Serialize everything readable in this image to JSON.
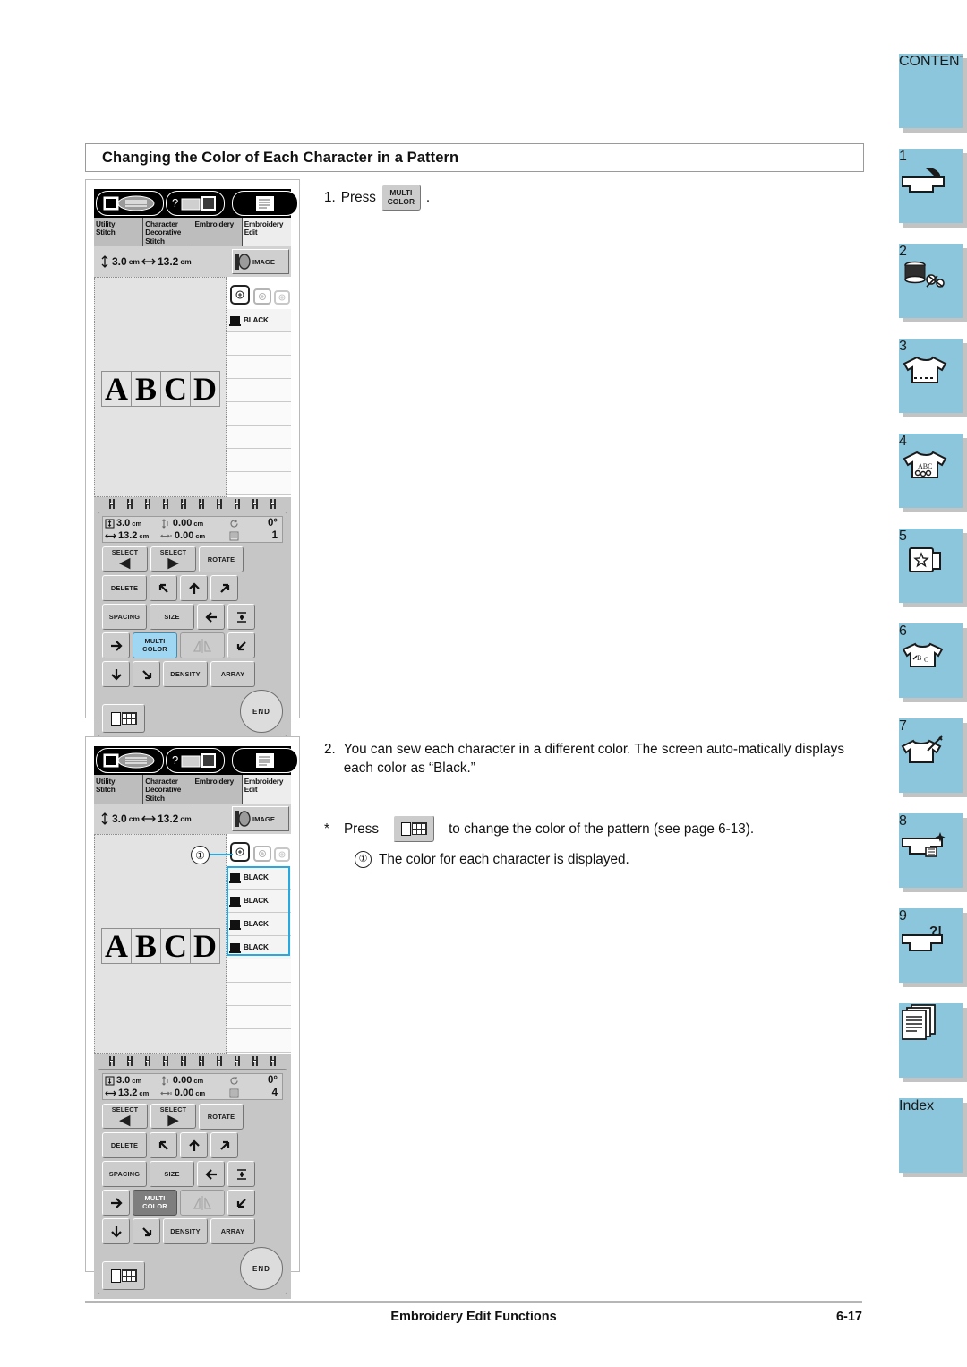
{
  "section": {
    "heading": "Changing the Color of Each Character in a Pattern"
  },
  "steps": {
    "step1": {
      "number": "1.",
      "press_label": "Press",
      "key_line1": "MULTI",
      "key_line2": "COLOR",
      "period": "."
    },
    "step2": {
      "number": "2.",
      "text": "You can sew each character in a different color. The screen auto-matically displays each color as “Black.”"
    },
    "note": {
      "bullet": "*",
      "press_label": "Press",
      "text_after": "to change the color of the pattern (see page 6-13).",
      "sub_marker": "①",
      "sub_text": "The color for each character is displayed."
    }
  },
  "callout": {
    "marker": "①"
  },
  "screen": {
    "tabs": [
      {
        "label": "Utility\nStitch",
        "active": false
      },
      {
        "label": "Character\nDecorative\nStitch",
        "active": false
      },
      {
        "label": "Embroidery",
        "active": false
      },
      {
        "label": "Embroidery\nEdit",
        "active": true
      }
    ],
    "size": {
      "height": "3.0",
      "height_unit": "cm",
      "width": "13.2",
      "width_unit": "cm"
    },
    "image_button": "IMAGE",
    "pattern_chars": [
      "A",
      "B",
      "C",
      "D"
    ],
    "color_name": "BLACK",
    "readout": {
      "size_h": "3.0",
      "size_h_unit": "cm",
      "size_w": "13.2",
      "size_w_unit": "cm",
      "pos_v": "0.00",
      "pos_v_unit": "cm",
      "pos_h": "0.00",
      "pos_h_unit": "cm",
      "rotation": "0°",
      "color_count_screen1": "1",
      "color_count_screen2": "4"
    },
    "keys": {
      "select_left_1": "SELECT",
      "select_left_2": "◀",
      "select_right_1": "SELECT",
      "select_right_2": "▶",
      "rotate": "ROTATE",
      "delete": "DELETE",
      "spacing": "SPACING",
      "size": "SIZE",
      "multi_1": "MULTI",
      "multi_2": "COLOR",
      "density": "DENSITY",
      "array": "ARRAY",
      "end": "END"
    }
  },
  "screen1": {
    "colors": [
      "BLACK"
    ],
    "multicolor_state": "highlighted",
    "color_count": "1"
  },
  "screen2": {
    "colors": [
      "BLACK",
      "BLACK",
      "BLACK",
      "BLACK"
    ],
    "multicolor_state": "pressed",
    "color_count": "4"
  },
  "side_tabs": [
    {
      "id": "contents",
      "label": "CONTENTS",
      "number": ""
    },
    {
      "id": "chapter-1",
      "label": "",
      "number": "1"
    },
    {
      "id": "chapter-2",
      "label": "",
      "number": "2"
    },
    {
      "id": "chapter-3",
      "label": "",
      "number": "3"
    },
    {
      "id": "chapter-4",
      "label": "",
      "number": "4"
    },
    {
      "id": "chapter-5",
      "label": "",
      "number": "5"
    },
    {
      "id": "chapter-6",
      "label": "",
      "number": "6"
    },
    {
      "id": "chapter-7",
      "label": "",
      "number": "7"
    },
    {
      "id": "chapter-8",
      "label": "",
      "number": "8"
    },
    {
      "id": "chapter-9",
      "label": "",
      "number": "9"
    },
    {
      "id": "appendix",
      "label": "",
      "number": ""
    },
    {
      "id": "index",
      "label": "Index",
      "number": ""
    }
  ],
  "footer": {
    "title": "Embroidery Edit Functions",
    "page": "6-17"
  },
  "colors": {
    "accent_blue": "#8cc6dc",
    "corner_blue": "#18a8e0",
    "highlight_blue": "#9fd6f2"
  }
}
